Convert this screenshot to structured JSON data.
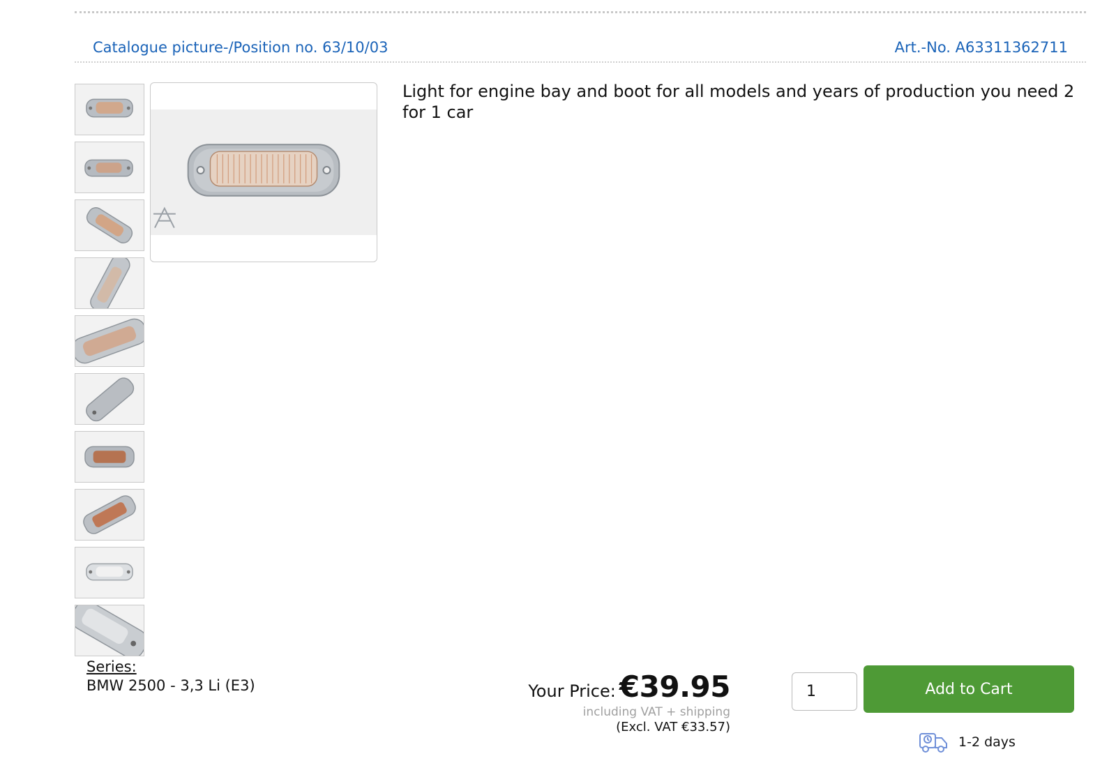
{
  "header": {
    "catalogue_position": "Catalogue picture-/Position no. 63/10/03",
    "article_number": "Art.-No. A63311362711"
  },
  "product": {
    "description": "Light for engine bay and boot for all models and years of production you need 2 for 1 car",
    "thumbnails": [
      {
        "icon": "product-photo-front"
      },
      {
        "icon": "product-photo-front"
      },
      {
        "icon": "product-photo-angled"
      },
      {
        "icon": "product-photo-angled"
      },
      {
        "icon": "product-photo-closeup"
      },
      {
        "icon": "product-photo-angled"
      },
      {
        "icon": "product-photo-back"
      },
      {
        "icon": "product-photo-back"
      },
      {
        "icon": "product-photo-front"
      },
      {
        "icon": "product-photo-closeup"
      }
    ]
  },
  "series": {
    "label": "Series:",
    "value": "BMW 2500 - 3,3 Li (E3)"
  },
  "pricing": {
    "label": "Your Price:",
    "price": "€39.95",
    "vat_note": "including VAT + shipping",
    "excl_vat": "(Excl. VAT €33.57)"
  },
  "cart": {
    "quantity": "1",
    "button_label": "Add to Cart"
  },
  "delivery": {
    "icon": "delivery-truck-icon",
    "text": "1-2 days"
  },
  "colors": {
    "link_blue": "#1a63b8",
    "cart_green": "#4e9a36",
    "delivery_icon_blue": "#6f8fd8"
  }
}
